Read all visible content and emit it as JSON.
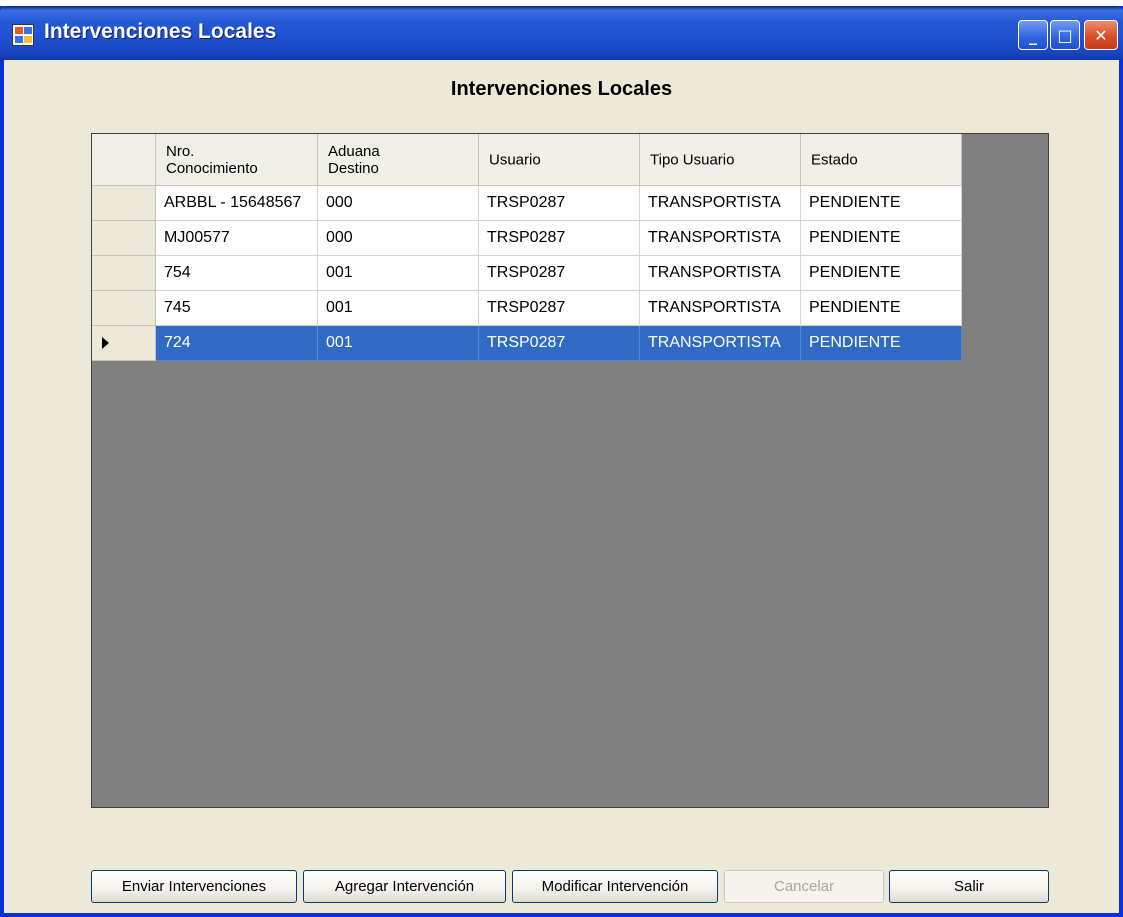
{
  "window": {
    "title": "Intervenciones Locales",
    "controls": {
      "minimize": "_",
      "maximize": "□",
      "close": "✕"
    }
  },
  "heading": "Intervenciones Locales",
  "grid": {
    "columns": [
      "Nro.\nConocimiento",
      "Aduana\nDestino",
      "Usuario",
      "Tipo Usuario",
      "Estado"
    ],
    "rows": [
      [
        "ARBBL - 15648567",
        "000",
        "TRSP0287",
        "TRANSPORTISTA",
        "PENDIENTE"
      ],
      [
        "MJ00577",
        "000",
        "TRSP0287",
        "TRANSPORTISTA",
        "PENDIENTE"
      ],
      [
        "754",
        "001",
        "TRSP0287",
        "TRANSPORTISTA",
        "PENDIENTE"
      ],
      [
        "745",
        "001",
        "TRSP0287",
        "TRANSPORTISTA",
        "PENDIENTE"
      ],
      [
        "724",
        "001",
        "TRSP0287",
        "TRANSPORTISTA",
        "PENDIENTE"
      ]
    ],
    "selected_row": 4
  },
  "buttons": {
    "enviar": "Enviar Intervenciones",
    "agregar": "Agregar Intervención",
    "modificar": "Modificar Intervención",
    "cancelar": "Cancelar",
    "salir": "Salir"
  },
  "colors": {
    "selection": "#316ac5",
    "window_bg": "#ece9d8",
    "grid_bg": "#808080"
  }
}
